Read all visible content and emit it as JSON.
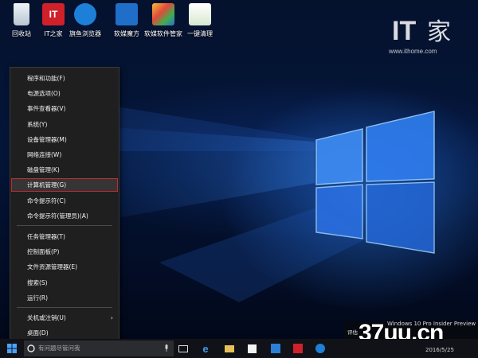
{
  "desktop": {
    "icons": [
      {
        "label": "回收站",
        "icon": "recycle-bin-icon"
      },
      {
        "label": "IT之家",
        "icon": "ithome-app-icon"
      },
      {
        "label": "旗鱼浏览器",
        "icon": "qiyu-browser-icon"
      },
      {
        "label": "软媒魔方",
        "icon": "ruanmei-mofang-icon"
      },
      {
        "label": "软媒软件管家",
        "icon": "ruanmei-software-manager-icon"
      },
      {
        "label": "一键清理",
        "icon": "one-click-clean-icon"
      }
    ],
    "logo": {
      "text": "IT之家",
      "url": "www.ithome.com"
    }
  },
  "winx_menu": {
    "items": [
      {
        "label": "程序和功能(F)"
      },
      {
        "label": "电源选项(O)"
      },
      {
        "label": "事件查看器(V)"
      },
      {
        "label": "系统(Y)"
      },
      {
        "label": "设备管理器(M)"
      },
      {
        "label": "网络连接(W)"
      },
      {
        "label": "磁盘管理(K)"
      },
      {
        "label": "计算机管理(G)",
        "highlighted": true
      },
      {
        "label": "命令提示符(C)"
      },
      {
        "label": "命令提示符(管理员)(A)"
      },
      {
        "label": "任务管理器(T)"
      },
      {
        "label": "控制面板(P)"
      },
      {
        "label": "文件资源管理器(E)"
      },
      {
        "label": "搜索(S)"
      },
      {
        "label": "运行(R)"
      },
      {
        "label": "关机或注销(U)",
        "has_submenu": true
      },
      {
        "label": "桌面(D)"
      }
    ],
    "highlight_color": "#c42a2a"
  },
  "taskbar": {
    "start_icon": "windows-start-icon",
    "search_placeholder": "有问题尽管问我",
    "apps": [
      "task-view-icon",
      "edge-icon",
      "file-explorer-icon",
      "store-icon",
      "ruanmei-mofang-icon",
      "ithome-app-icon",
      "qiyu-browser-icon"
    ]
  },
  "watermark": {
    "build_text": "评估",
    "edition_text": "Windows 10 Pro Insider Preview",
    "site_brand": "37uu.cn",
    "date": "2016/5/25"
  }
}
